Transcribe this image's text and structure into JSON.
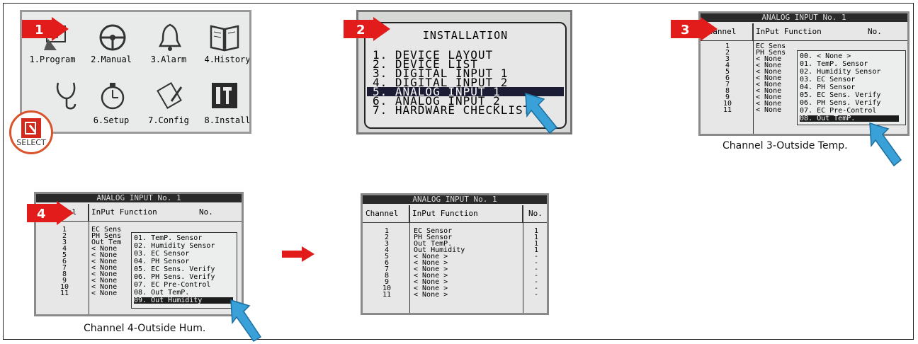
{
  "steps": [
    "1",
    "2",
    "3",
    "4"
  ],
  "menu": {
    "items": [
      {
        "label": "1.Program",
        "icon": "program-hand-icon"
      },
      {
        "label": "2.Manual",
        "icon": "steering-wheel-icon"
      },
      {
        "label": "3.Alarm",
        "icon": "bell-icon"
      },
      {
        "label": "4.History",
        "icon": "book-icon"
      },
      {
        "label": "",
        "icon": "stethoscope-icon"
      },
      {
        "label": "6.Setup",
        "icon": "stopwatch-icon"
      },
      {
        "label": "7.Config",
        "icon": "config-pencil-icon"
      },
      {
        "label": "8.Install",
        "icon": "tools-icon"
      }
    ],
    "select_label": "SELECT"
  },
  "installation": {
    "title": "INSTALLATION",
    "rows": [
      "1. DEVICE LAYOUT",
      "2. DEVICE LIST",
      "3. DIGITAL INPUT 1",
      "4. DIGITAL INPUT 2",
      "5. ANALOG INPUT 1",
      "6. ANALOG INPUT 2",
      "7. HARDWARE CHECKLIST"
    ],
    "selected_index": 4
  },
  "analog": {
    "header": "ANALOG INPUT No.  1",
    "col_channel": "Channel",
    "col_channel_short": "annel",
    "col_function": "InPut Function",
    "col_no": "No.",
    "channels": [
      "1",
      "2",
      "3",
      "4",
      "5",
      "6",
      "7",
      "8",
      "9",
      "10",
      "11"
    ],
    "options": [
      "00. < None >",
      "01. TemP. Sensor",
      "02. Humidity Sensor",
      "03. EC Sensor",
      "04. PH Sensor",
      "05. EC Sens. Verify",
      "06. PH Sens. Verify",
      "07. EC Pre-Control",
      "08. Out TemP.",
      "09. Out Humidity"
    ]
  },
  "panel3": {
    "functions": [
      "EC Sens",
      "PH Sens",
      "< None",
      "< None",
      "< None",
      "< None",
      "< None",
      "< None",
      "< None",
      "< None",
      "< None"
    ],
    "caption": "Channel 3-Outside Temp."
  },
  "panel4": {
    "functions": [
      "EC Sens",
      "PH Sens",
      "Out Tem",
      "< None",
      "< None",
      "< None",
      "< None",
      "< None",
      "< None",
      "< None",
      "< None"
    ],
    "caption": "Channel 4-Outside Hum."
  },
  "panel5": {
    "functions": [
      "EC Sensor",
      "PH Sensor",
      "Out TemP.",
      "Out Humidity",
      "< None >",
      "< None >",
      "< None >",
      "< None >",
      "< None >",
      "< None >",
      "< None >"
    ],
    "numbers": [
      "1",
      "1",
      "1",
      "1",
      "-",
      "-",
      "-",
      "-",
      "-",
      "-",
      "-"
    ]
  }
}
